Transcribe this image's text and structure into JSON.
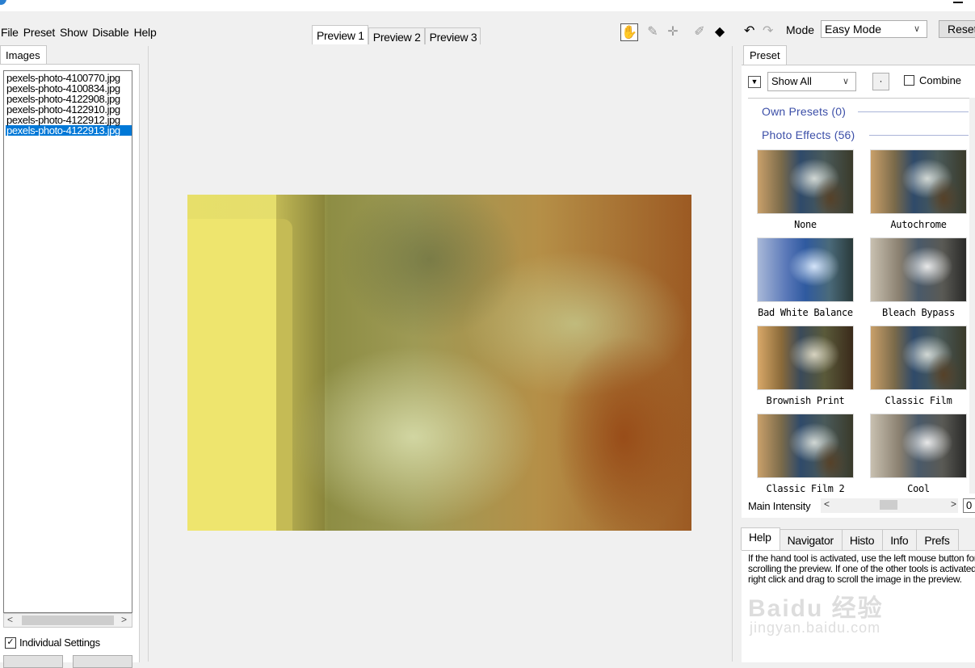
{
  "menu": [
    "File",
    "Preset",
    "Show",
    "Disable",
    "Help"
  ],
  "left_panel": {
    "tab": "Images",
    "files": [
      "pexels-photo-4100770.jpg",
      "pexels-photo-4100834.jpg",
      "pexels-photo-4122908.jpg",
      "pexels-photo-4122910.jpg",
      "pexels-photo-4122912.jpg",
      "pexels-photo-4122913.jpg"
    ],
    "selected_file": "pexels-photo-4122913.jpg",
    "individual_settings_label": "Individual Settings",
    "individual_settings_checked": true
  },
  "preview_tabs": [
    "Preview 1",
    "Preview 2",
    "Preview 3"
  ],
  "active_preview_tab": "Preview 1",
  "toolbar": {
    "tools": [
      "hand-tool",
      "eyedropper-tool",
      "crosshair-tool",
      "brush-tool",
      "split-tool"
    ],
    "active_tool": "hand-tool"
  },
  "mode": {
    "label": "Mode",
    "value": "Easy Mode",
    "reset_label": "Reset"
  },
  "preset_panel": {
    "tab": "Preset",
    "filter_value": "Show All",
    "dot_button": "·",
    "combine_label": "Combine",
    "combine_checked": false,
    "groups": [
      {
        "title": "Own Presets (0)"
      },
      {
        "title": "Photo Effects (56)"
      }
    ],
    "presets": [
      "None",
      "Autochrome",
      "Bad White Balance",
      "Bleach Bypass",
      "Brownish Print",
      "Classic Film",
      "Classic Film 2",
      "Cool"
    ]
  },
  "intensity": {
    "label": "Main Intensity",
    "value": "0"
  },
  "help_tabs": [
    "Help",
    "Navigator",
    "Histo",
    "Info",
    "Prefs"
  ],
  "active_help_tab": "Help",
  "help_text": "If the hand tool is activated, use the left mouse button for scrolling the preview. If one of the other tools is activated, right click and drag to scroll the image in the preview.",
  "watermark": {
    "logo": "Baidu 经验",
    "url": "jingyan.baidu.com"
  },
  "colors": {
    "selection": "#0078d7",
    "group_header": "#3c4fa8"
  }
}
